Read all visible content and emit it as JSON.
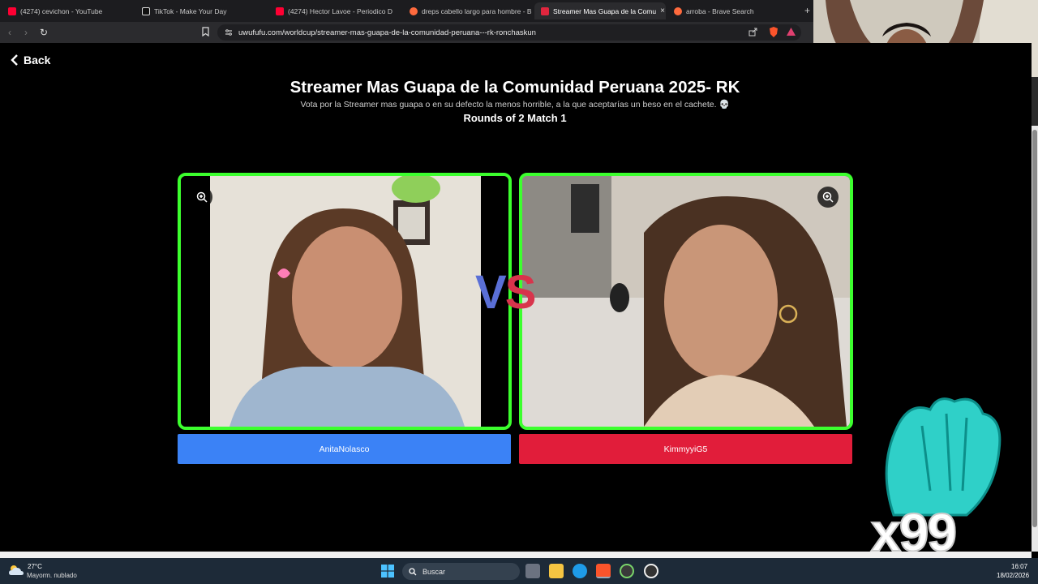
{
  "browser": {
    "tabs": [
      {
        "title": "(4274) cevichon - YouTube",
        "favicon": "youtube-icon",
        "color": "#ff0033"
      },
      {
        "title": "TikTok - Make Your Day",
        "favicon": "tiktok-icon",
        "color": "#ffffff"
      },
      {
        "title": "(4274) Hector Lavoe - Periodico D",
        "favicon": "youtube-icon",
        "color": "#ff0033"
      },
      {
        "title": "dreps cabello largo para hombre - B",
        "favicon": "brave-search-icon",
        "color": "#ff6a3d"
      },
      {
        "title": "Streamer Mas Guapa de la Comu",
        "favicon": "uwufufu-icon",
        "color": "#e0263e",
        "active": true
      },
      {
        "title": "arroba - Brave Search",
        "favicon": "brave-search-icon",
        "color": "#ff6a3d"
      }
    ],
    "close_symbol": "×",
    "new_tab_symbol": "+",
    "url": "uwufufu.com/worldcup/streamer-mas-guapa-de-la-comunidad-peruana---rk-ronchaskun"
  },
  "page": {
    "back_label": "Back",
    "title": "Streamer Mas Guapa de la Comunidad Peruana 2025- RK",
    "subtitle": "Vota por la Streamer mas guapa o en su defecto la menos horrible, a la que aceptarías un beso en el cachete. 💀",
    "rounds": "Rounds of 2 Match 1",
    "vs": {
      "v": "V",
      "s": "S",
      "v_color": "#5a6fd6",
      "s_color": "#d8344c"
    },
    "left": {
      "name": "AnitaNolasco",
      "button_color": "#3b82f6"
    },
    "right": {
      "name": "KimmyyiG5",
      "button_color": "#e11d3a"
    },
    "border_color": "#3cff2e"
  },
  "overlay": {
    "multiplier": "x99"
  },
  "taskbar": {
    "weather_temp": "27°C",
    "weather_desc": "Mayorm. nublado",
    "search_placeholder": "Buscar",
    "time": "16:07",
    "date": "18/02/2026"
  }
}
